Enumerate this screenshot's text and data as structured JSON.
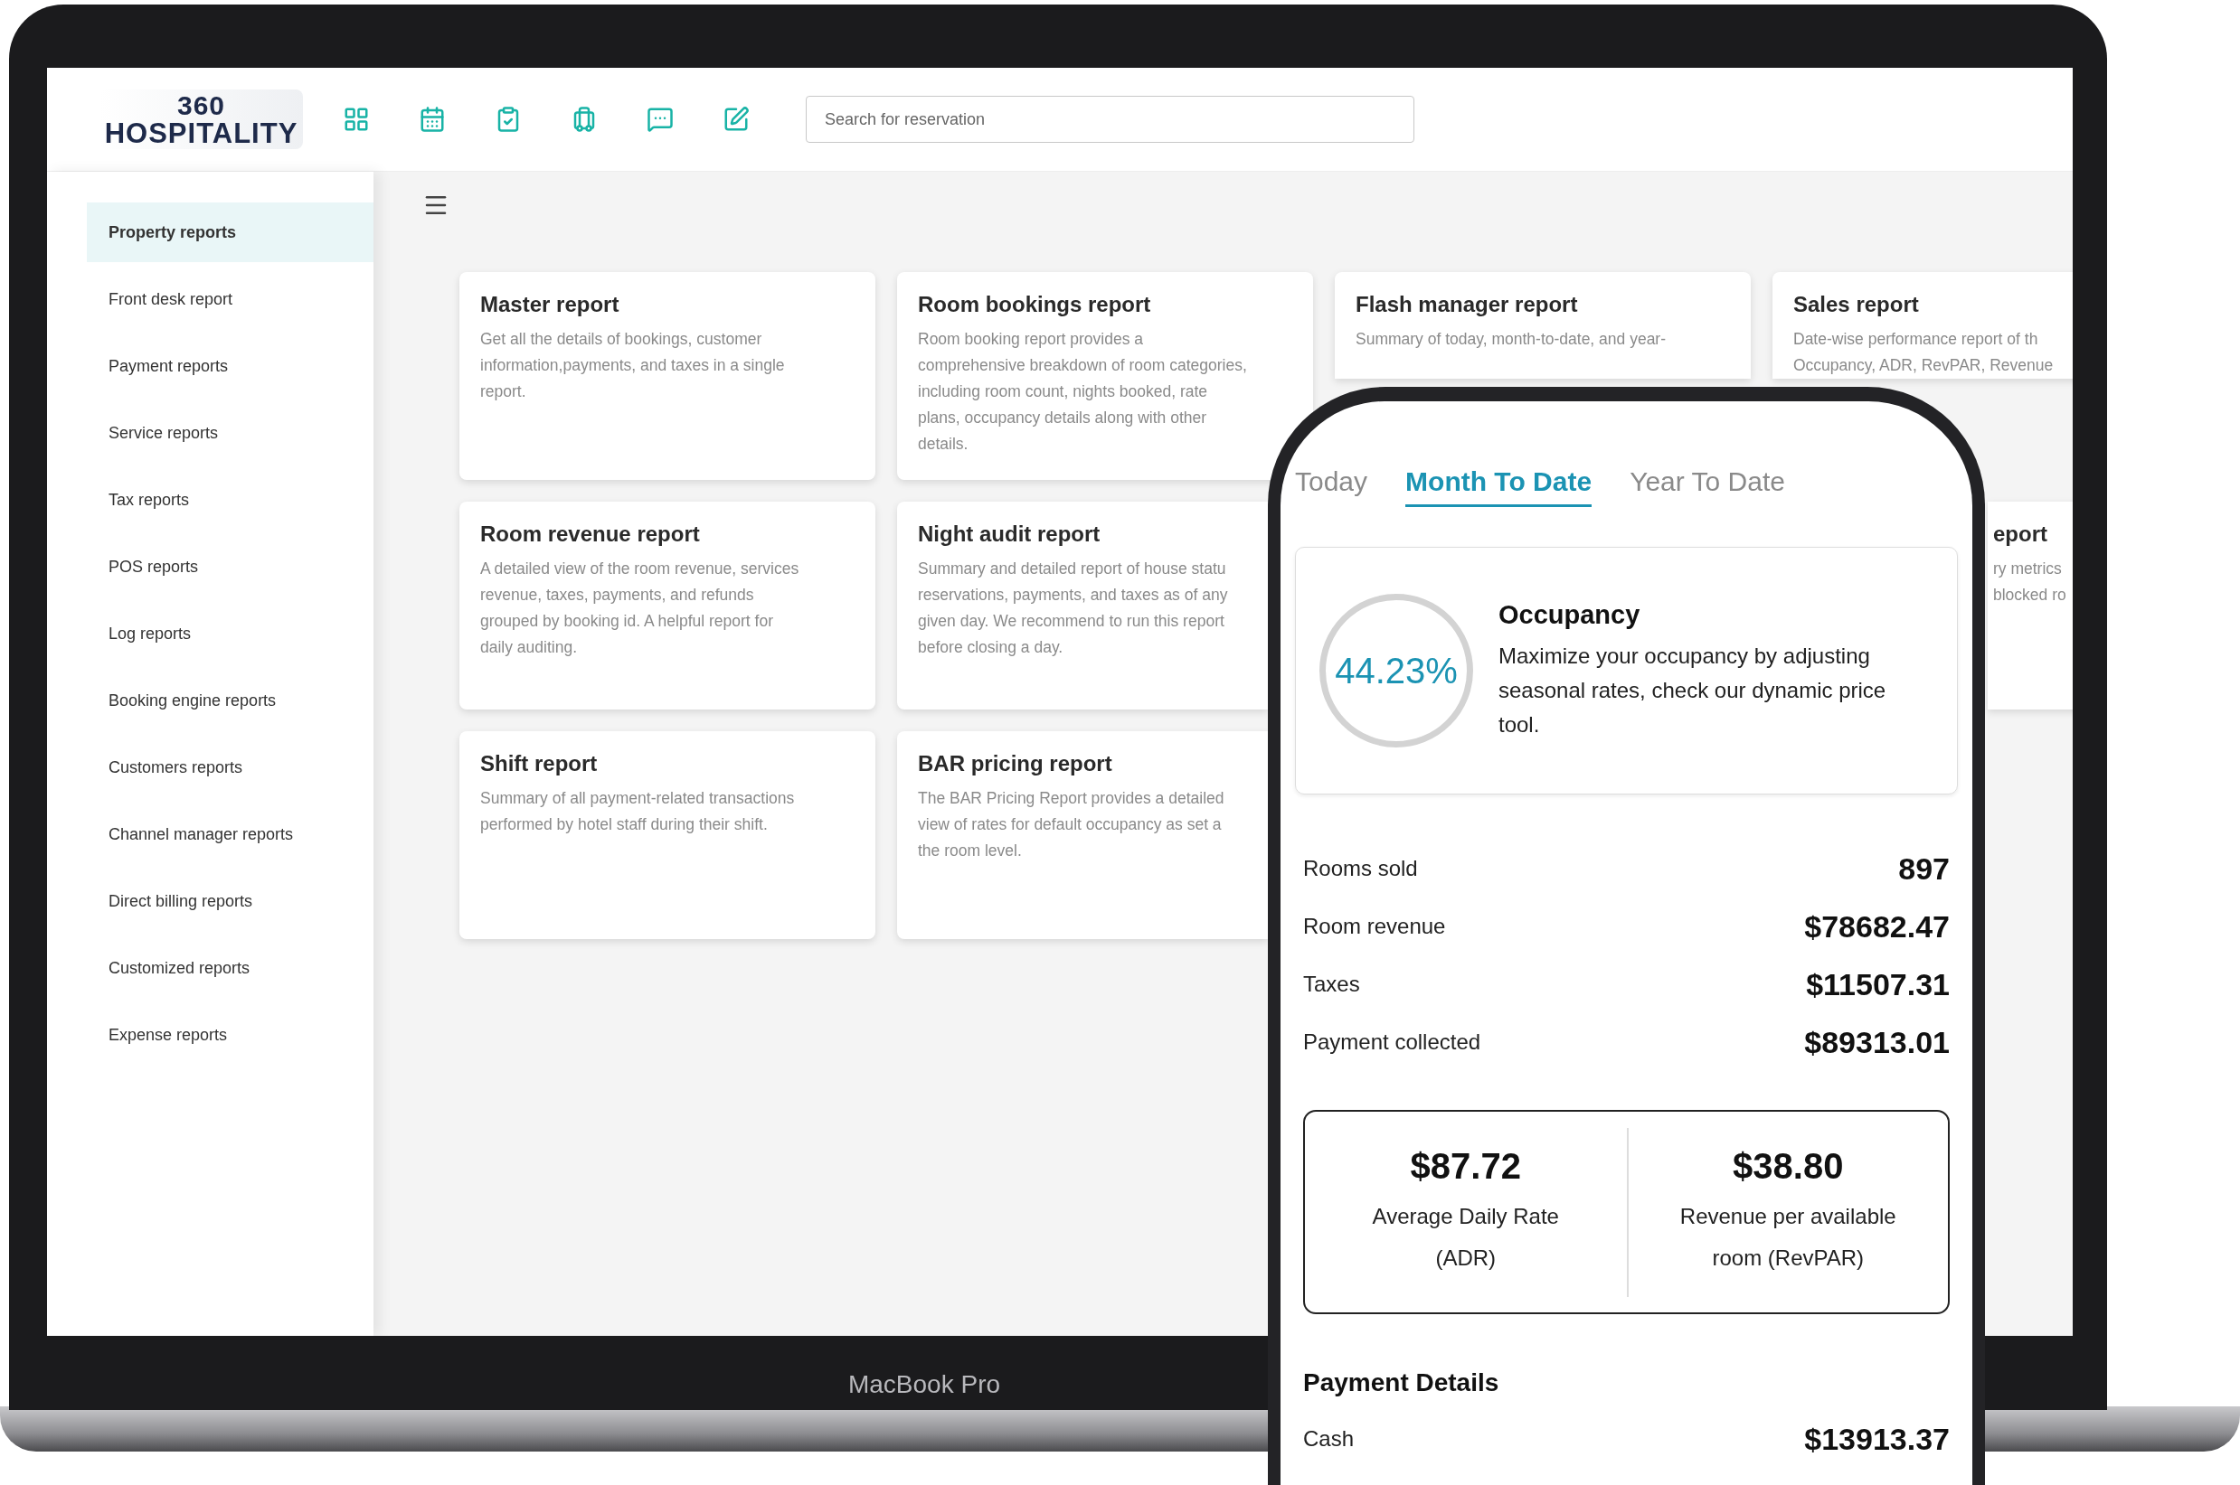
{
  "logo": {
    "line_1": "360",
    "line_2": "HOSPITALITY"
  },
  "search": {
    "placeholder": "Search for reservation"
  },
  "sidebar": {
    "items": [
      {
        "label": "Property reports",
        "selected": true
      },
      {
        "label": "Front desk report",
        "selected": false
      },
      {
        "label": "Payment reports",
        "selected": false
      },
      {
        "label": "Service reports",
        "selected": false
      },
      {
        "label": "Tax reports",
        "selected": false
      },
      {
        "label": "POS reports",
        "selected": false
      },
      {
        "label": "Log reports",
        "selected": false
      },
      {
        "label": "Booking engine reports",
        "selected": false
      },
      {
        "label": "Customers reports",
        "selected": false
      },
      {
        "label": "Channel manager reports",
        "selected": false
      },
      {
        "label": "Direct billing reports",
        "selected": false
      },
      {
        "label": "Customized reports",
        "selected": false
      },
      {
        "label": "Expense reports",
        "selected": false
      }
    ]
  },
  "report_cards": [
    {
      "kind": "full",
      "title": "Master report",
      "description": "Get all the details of bookings, customer\ninformation,payments, and taxes in a single\nreport."
    },
    {
      "kind": "full",
      "title": "Room bookings report",
      "description": "Room booking report provides a\ncomprehensive breakdown of room categories,\nincluding room count, nights booked, rate\nplans, occupancy details along with other\ndetails."
    },
    {
      "kind": "cut_bottom",
      "title": "Flash manager report",
      "description": "Summary of today, month-to-date, and year-"
    },
    {
      "kind": "cut_bottom",
      "title": "Sales report",
      "description": "Date-wise performance report of th\nOccupancy, ADR, RevPAR, Revenue"
    },
    {
      "kind": "full",
      "title": "Room revenue report",
      "description": "A detailed view of the room revenue, services\nrevenue, taxes, payments, and refunds\ngrouped by booking id. A helpful report for\ndaily auditing."
    },
    {
      "kind": "cut_right",
      "title": "Night audit report",
      "description": "Summary and detailed report of house statu\nreservations, payments, and taxes as of any\ngiven day. We recommend to run this report\nbefore closing a day."
    },
    {
      "kind": "clipped",
      "title": "eport",
      "description": "ry metrics\nblocked ro"
    },
    {
      "kind": "full",
      "title": "Shift report",
      "description": "Summary of all payment-related transactions\nperformed by hotel staff during their shift."
    },
    {
      "kind": "cut_right",
      "title": "BAR pricing report",
      "description": "The BAR Pricing Report provides a detailed\nview of rates for default occupancy as set a\nthe room level."
    }
  ],
  "device_label": "MacBook Pro",
  "phone": {
    "tabs": [
      {
        "label": "Today",
        "selected": false
      },
      {
        "label": "Month To Date",
        "selected": true
      },
      {
        "label": "Year To Date",
        "selected": false
      }
    ],
    "occupancy": {
      "value": "44.23%",
      "title": "Occupancy",
      "text": "Maximize your occupancy by adjusting seasonal rates, check our dynamic price tool."
    },
    "stats": [
      {
        "label": "Rooms sold",
        "value": "897"
      },
      {
        "label": "Room revenue",
        "value": "$78682.47"
      },
      {
        "label": "Taxes",
        "value": "$11507.31"
      },
      {
        "label": "Payment collected",
        "value": "$89313.01"
      }
    ],
    "rates": [
      {
        "value": "$87.72",
        "label": "Average Daily Rate\n(ADR)"
      },
      {
        "value": "$38.80",
        "label": "Revenue per available\nroom (RevPAR)"
      }
    ],
    "payment_details": {
      "title": "Payment Details",
      "rows": [
        {
          "label": "Cash",
          "value": "$13913.37"
        }
      ]
    }
  }
}
